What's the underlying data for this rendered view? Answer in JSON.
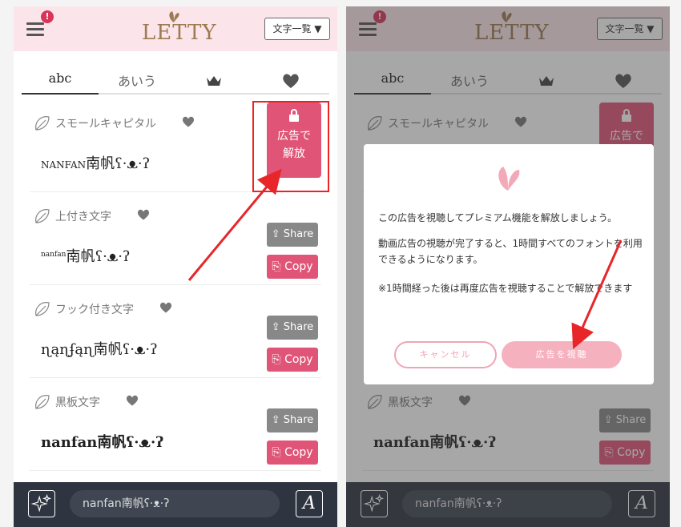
{
  "header": {
    "logo_text": "LETTY",
    "font_list_label": "文字一覧 ▼",
    "alert_badge": "!"
  },
  "tabs": [
    {
      "label": "abc"
    },
    {
      "label": "あいう"
    },
    {
      "label": "",
      "icon": "crown-icon"
    },
    {
      "label": "",
      "icon": "heart-icon"
    }
  ],
  "rows": [
    {
      "name": "スモールキャピタル",
      "sample_prefix": "NANFAN",
      "sample_suffix": "南帆ʕ·ᴥ·ʔ",
      "locked": true
    },
    {
      "name": "上付き文字",
      "sample_prefix": "nanfan",
      "sample_suffix": "南帆ʕ·ᴥ·ʔ",
      "locked": false
    },
    {
      "name": "フック付き文字",
      "sample_prefix": "ɳąɳʄąɳ",
      "sample_suffix": "南帆ʕ·ᴥ·ʔ",
      "locked": false
    },
    {
      "name": "黒板文字",
      "sample_prefix": "nanfan",
      "sample_suffix": "南帆ʕ·ᴥ·ʔ",
      "locked": false
    }
  ],
  "buttons": {
    "share": "Share",
    "copy": "Copy",
    "unlock_line1": "広告で",
    "unlock_line2": "解放"
  },
  "bottom": {
    "input_value": "nanfan南帆ʕ·ᴥ·ʔ",
    "font_button": "A"
  },
  "modal": {
    "line1": "この広告を視聴してプレミアム機能を解放しましょう。",
    "line2": "動画広告の視聴が完了すると、1時間すべてのフォントを利用できるようになります。",
    "line3": "※1時間経った後は再度広告を視聴することで解放できます",
    "cancel": "キャンセル",
    "watch": "広告を視聴"
  },
  "colors": {
    "header_bg": "#fbe5ea",
    "accent_pink": "#e05577",
    "share_gray": "#888888",
    "bottom_bar": "#2f3540",
    "arrow_red": "#e8262a"
  }
}
